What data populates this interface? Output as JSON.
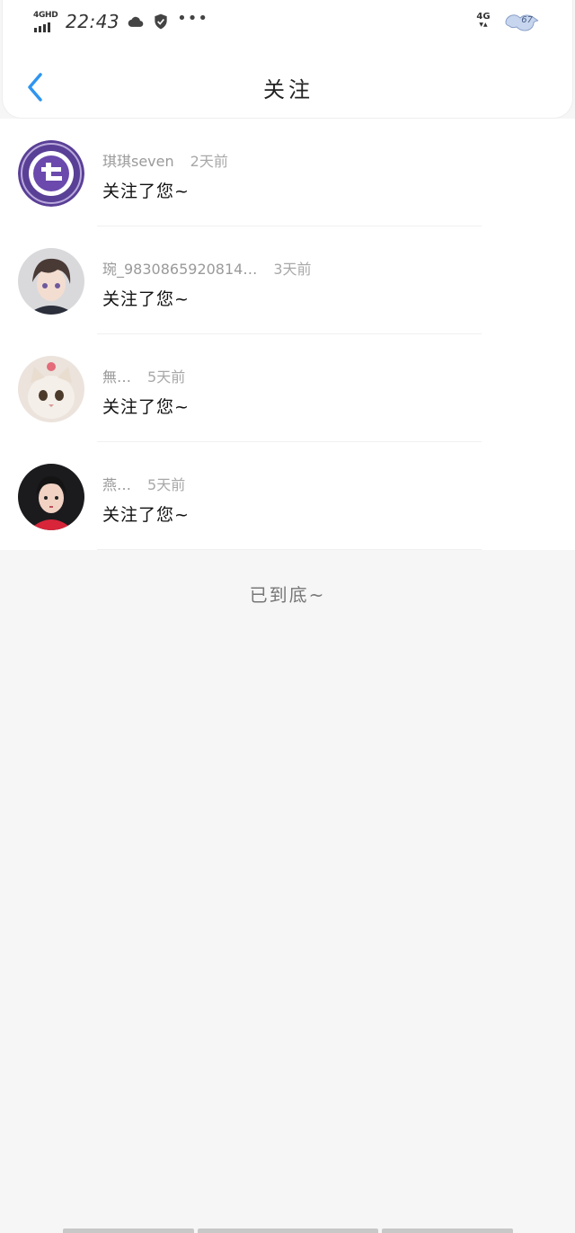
{
  "status_bar": {
    "network_left": "4GHD",
    "time": "22:43",
    "network_right": "4G",
    "battery": "67"
  },
  "nav": {
    "title": "关注"
  },
  "list": {
    "items": [
      {
        "name": "琪琪seven",
        "time": "2天前",
        "message": "关注了您~"
      },
      {
        "name": "琬_9830865920814…",
        "time": "3天前",
        "message": "关注了您~"
      },
      {
        "name": "無…",
        "time": "5天前",
        "message": "关注了您~"
      },
      {
        "name": "燕…",
        "time": "5天前",
        "message": "关注了您~"
      }
    ]
  },
  "footer": {
    "end_text": "已到底~"
  }
}
